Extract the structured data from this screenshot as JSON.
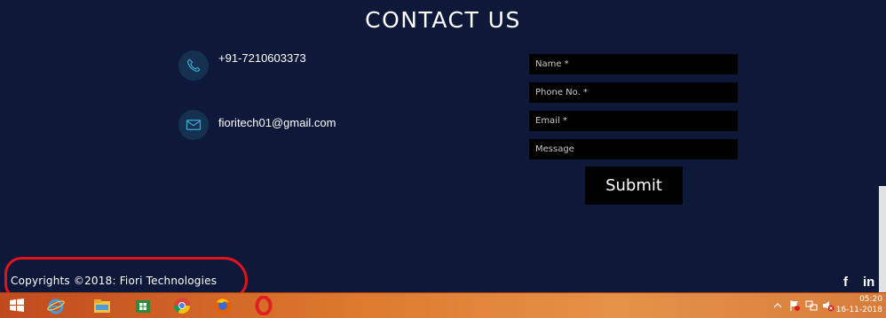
{
  "section": {
    "title": "CONTACT US"
  },
  "contact": {
    "phone": "+91-7210603373",
    "email": "fioritech01@gmail.com"
  },
  "form": {
    "name_placeholder": "Name *",
    "phone_placeholder": "Phone No. *",
    "email_placeholder": "Email *",
    "message_placeholder": "Message",
    "submit_label": "Submit"
  },
  "footer": {
    "copyright": "Copyrights ©2018: Fiori Technologies",
    "social": {
      "facebook": "f",
      "linkedin": "in"
    }
  },
  "taskbar": {
    "time": "05:20",
    "date": "16-11-2018"
  },
  "colors": {
    "background": "#0e1838",
    "annotation": "#e0141e",
    "taskbar": "#dd7a2e"
  }
}
